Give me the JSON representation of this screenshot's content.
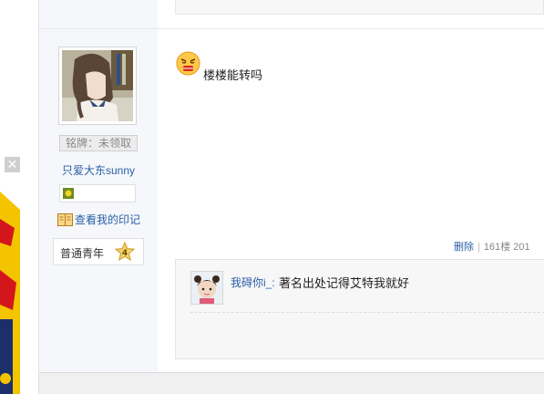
{
  "ad": {
    "close_label": "✕"
  },
  "author": {
    "medal_label": "铭牌：未领取",
    "username": "只爱大东sunny",
    "imprint_link": "查看我的印记",
    "rank_title": "普通青年",
    "rank_level": "4"
  },
  "post": {
    "text": "楼楼能转吗",
    "actions": {
      "delete": "删除",
      "separator": "|",
      "floor": "161楼",
      "date_partial": "201"
    }
  },
  "reply": {
    "username": "我碍你i_:",
    "text": "著名出处记得艾特我就好"
  },
  "colors": {
    "link": "#2a5fa8",
    "sidebar_bg": "#f5f7fa",
    "reply_bg": "#f7f7f7"
  }
}
